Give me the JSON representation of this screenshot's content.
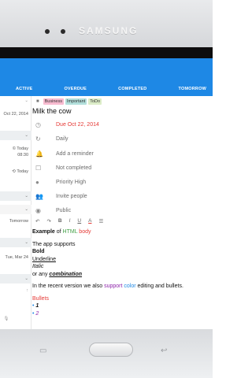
{
  "device": {
    "brand": "SAMSUNG"
  },
  "tabs": [
    "ACTIVE",
    "OVERDUE",
    "COMPLETED",
    "TOMORROW"
  ],
  "list": {
    "items": [
      {
        "text": "Oct 22, 2014"
      },
      {
        "text": "© Today"
      },
      {
        "text": "08:30"
      },
      {
        "text": "⟲ Today"
      },
      {
        "text": "Tomorrow"
      },
      {
        "text": "Tue, Mar 24"
      }
    ]
  },
  "detail": {
    "tags": [
      "Business",
      "Important",
      "ToDo"
    ],
    "tag_colors": [
      "#f8bbd0",
      "#b2dfdb",
      "#dcedc8"
    ],
    "title": "Milk the cow",
    "fields": {
      "due": "Due Oct 22, 2014",
      "repeat": "Daily",
      "reminder": "Add a reminder",
      "status": "Not completed",
      "priority": "Priority High",
      "invite": "Invite people",
      "visibility": "Public"
    },
    "toolbar": [
      "↶",
      "↷",
      "B",
      "I",
      "U",
      "A",
      "☰"
    ],
    "editor": {
      "example_prefix": "Example",
      "example_of": "of",
      "html_word": "HTML",
      "body_word": "body",
      "supports": "The app supports",
      "bold": "Bold",
      "underline": "Underline",
      "italic": "Italic",
      "or_any": "or any",
      "combination": "combination",
      "recent_prefix": "In the recent version we also",
      "support_word": "support",
      "color_word": "color",
      "recent_suffix": "editing and bullets.",
      "bullets": "Bullets",
      "bullet_items": [
        "1",
        "2"
      ]
    }
  },
  "colors": {
    "appbar": "#1e88e5",
    "due_red": "#e53935",
    "html_green": "#43a047",
    "purple": "#8e24aa",
    "blue": "#1e88e5"
  }
}
